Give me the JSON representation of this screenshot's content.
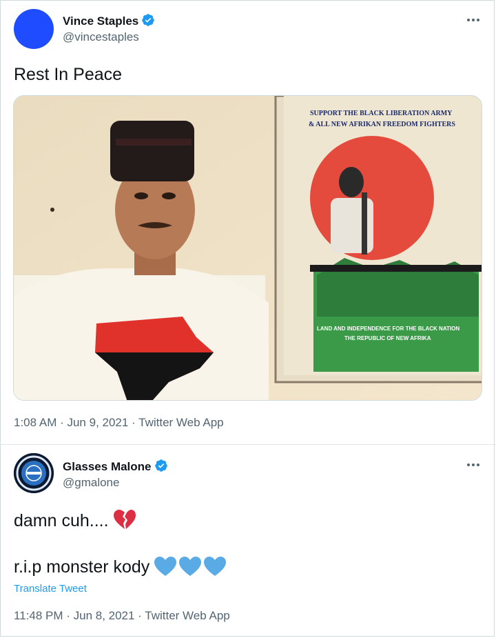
{
  "tweets": [
    {
      "name": "Vince Staples",
      "handle": "@vincestaples",
      "text": "Rest In Peace",
      "meta": "1:08 AM · Jun 9, 2021 · Twitter Web App",
      "media": {
        "poster_line1": "SUPPORT THE BLACK LIBERATION ARMY",
        "poster_line2": "& ALL NEW AFRIKAN FREEDOM FIGHTERS",
        "poster_bottom1": "LAND AND INDEPENDENCE FOR THE BLACK NATION",
        "poster_bottom2": "THE REPUBLIC OF NEW AFRIKA"
      }
    },
    {
      "name": "Glasses Malone",
      "handle": "@gmalone",
      "line1": "damn cuh....",
      "line2": "r.i.p monster kody",
      "translate": "Translate Tweet",
      "meta": "11:48 PM · Jun 8, 2021 · Twitter Web App"
    }
  ],
  "colors": {
    "verified": "#1d9bf0",
    "link": "#1d9bf0",
    "secondary_text": "#536471",
    "avatar1": "#1f4cff",
    "heart_blue": "#5aaae6",
    "broken_heart": "#dd2e44"
  },
  "icons": [
    "verified-badge-icon",
    "more-options-icon",
    "broken-heart-emoji",
    "blue-heart-emoji"
  ]
}
